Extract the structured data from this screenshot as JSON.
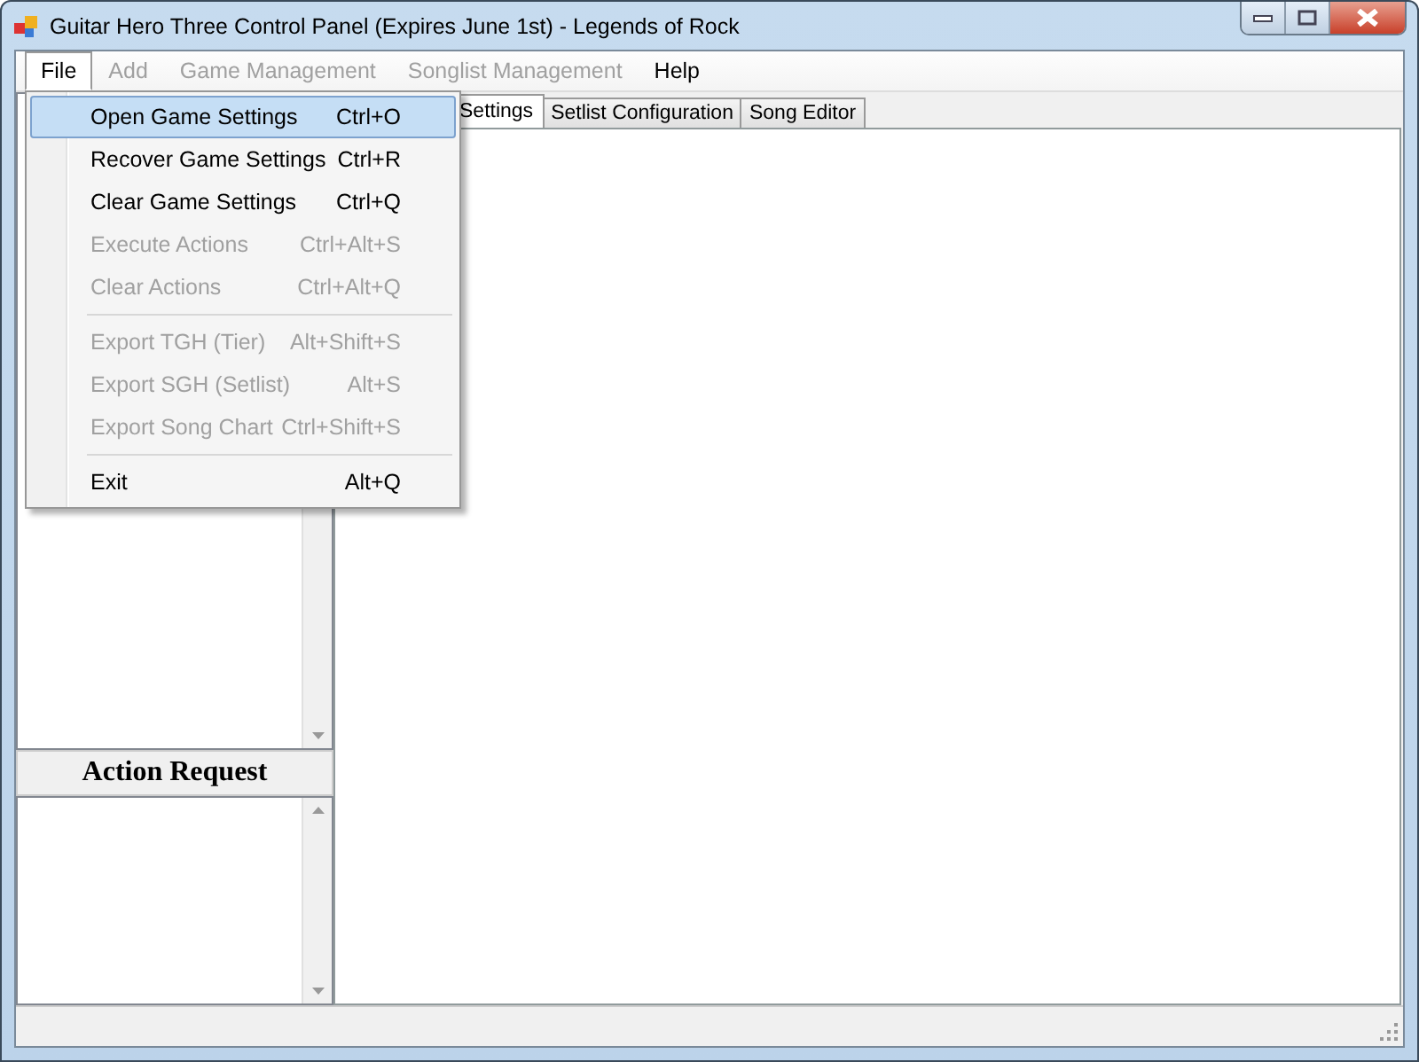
{
  "window": {
    "title": "Guitar Hero Three Control Panel (Expires June 1st) - Legends of Rock"
  },
  "menubar": [
    {
      "label": "File",
      "disabled": false,
      "open": true
    },
    {
      "label": "Add",
      "disabled": true,
      "open": false
    },
    {
      "label": "Game Management",
      "disabled": true,
      "open": false
    },
    {
      "label": "Songlist Management",
      "disabled": true,
      "open": false
    },
    {
      "label": "Help",
      "disabled": false,
      "open": false
    }
  ],
  "file_menu": {
    "groups": [
      [
        {
          "label": "Open Game Settings",
          "shortcut": "Ctrl+O",
          "disabled": false,
          "selected": true
        },
        {
          "label": "Recover Game Settings",
          "shortcut": "Ctrl+R",
          "disabled": false,
          "selected": false
        },
        {
          "label": "Clear Game Settings",
          "shortcut": "Ctrl+Q",
          "disabled": false,
          "selected": false
        },
        {
          "label": "Execute Actions",
          "shortcut": "Ctrl+Alt+S",
          "disabled": true,
          "selected": false
        },
        {
          "label": "Clear Actions",
          "shortcut": "Ctrl+Alt+Q",
          "disabled": true,
          "selected": false
        }
      ],
      [
        {
          "label": "Export TGH (Tier)",
          "shortcut": "Alt+Shift+S",
          "disabled": true,
          "selected": false
        },
        {
          "label": "Export SGH (Setlist)",
          "shortcut": "Alt+S",
          "disabled": true,
          "selected": false
        },
        {
          "label": "Export Song Chart",
          "shortcut": "Ctrl+Shift+S",
          "disabled": true,
          "selected": false
        }
      ],
      [
        {
          "label": "Exit",
          "shortcut": "Alt+Q",
          "disabled": false,
          "selected": false
        }
      ]
    ]
  },
  "tabs": [
    {
      "label": "Settings",
      "selected": true
    },
    {
      "label": "Setlist Configuration",
      "selected": false
    },
    {
      "label": "Song Editor",
      "selected": false
    }
  ],
  "action_request": {
    "title": "Action Request"
  }
}
